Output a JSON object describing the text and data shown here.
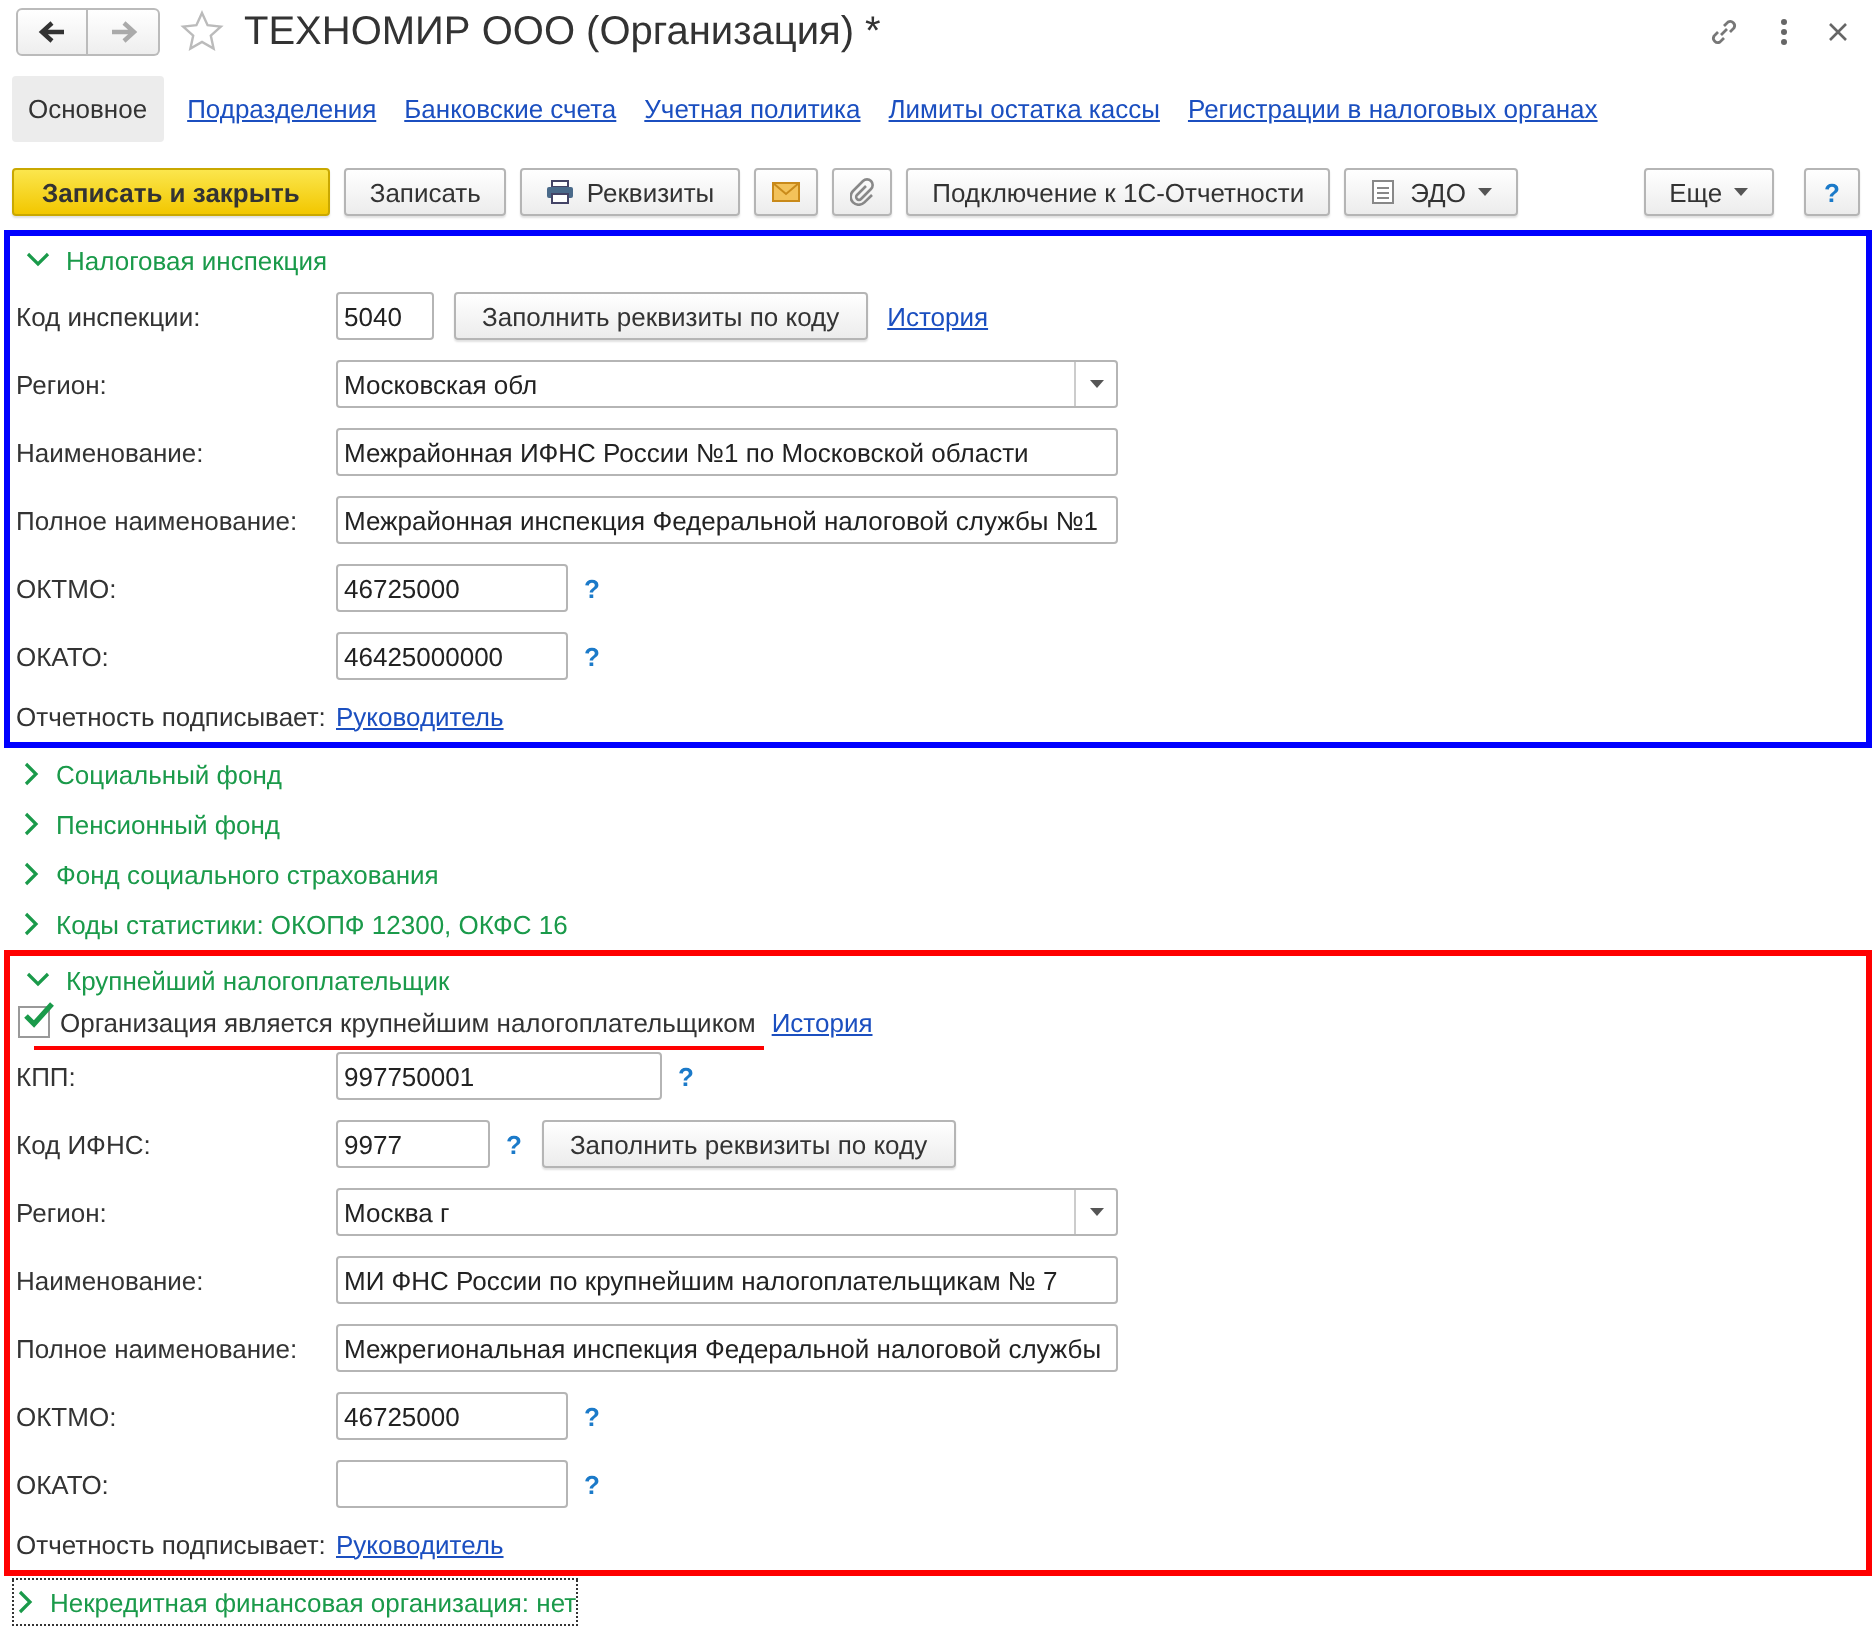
{
  "window": {
    "title": "ТЕХНОМИР ООО (Организация) *"
  },
  "tabs": [
    {
      "label": "Основное",
      "selected": true
    },
    {
      "label": "Подразделения",
      "selected": false
    },
    {
      "label": "Банковские счета",
      "selected": false
    },
    {
      "label": "Учетная политика",
      "selected": false
    },
    {
      "label": "Лимиты остатка кассы",
      "selected": false
    },
    {
      "label": "Регистрации в налоговых органах",
      "selected": false
    }
  ],
  "toolbar": [
    {
      "kind": "primary",
      "label": "Записать и закрыть"
    },
    {
      "kind": "plain",
      "label": "Записать"
    },
    {
      "kind": "printer",
      "label": "Реквизиты"
    },
    {
      "kind": "mail"
    },
    {
      "kind": "clip"
    },
    {
      "kind": "plain",
      "label": "Подключение к 1С-Отчетности"
    },
    {
      "kind": "menu-icon",
      "label": "ЭДО"
    }
  ],
  "toolbar_right": [
    {
      "kind": "menu",
      "label": "Еще"
    },
    {
      "kind": "plain",
      "label": "?"
    }
  ],
  "sections": [
    {
      "title": "Налоговая инспекция",
      "expanded": true,
      "color": "#0000ff",
      "rows": [
        {
          "kind": "code",
          "label": "Код инспекции:",
          "value": "5040",
          "button": "Заполнить реквизиты по коду",
          "link": "История"
        },
        {
          "kind": "select",
          "label": "Регион:",
          "value": "Московская обл"
        },
        {
          "kind": "text",
          "label": "Наименование:",
          "value": "Межрайонная ИФНС России №1 по Московской области"
        },
        {
          "kind": "text",
          "label": "Полное наименование:",
          "value": "Межрайонная инспекция Федеральной налоговой службы №1"
        },
        {
          "kind": "number",
          "label": "ОКТМО:",
          "value": "46725000",
          "help": "?"
        },
        {
          "kind": "number",
          "label": "ОКАТО:",
          "value": "46425000000",
          "help": "?"
        },
        {
          "kind": "link",
          "label": "Отчетность подписывает:",
          "link": "Руководитель"
        }
      ]
    },
    {
      "title": "Социальный фонд",
      "expanded": false
    },
    {
      "title": "Пенсионный фонд",
      "expanded": false
    },
    {
      "title": "Фонд социального страхования",
      "expanded": false
    },
    {
      "title": "Коды статистики: ОКОПФ 12300, ОКФС 16",
      "expanded": false
    },
    {
      "title": "Крупнейший налогоплательщик",
      "expanded": true,
      "color": "#ff0000",
      "rows": [
        {
          "kind": "checkbox",
          "label": "Организация является крупнейшим налогоплательщиком",
          "checked": true,
          "underlined": true,
          "link": "История"
        },
        {
          "kind": "kpp",
          "label": "КПП:",
          "value": "997750001",
          "help": "?"
        },
        {
          "kind": "ifns",
          "label": "Код ИФНС:",
          "value": "9977",
          "help": "?",
          "button": "Заполнить реквизиты по коду"
        },
        {
          "kind": "select",
          "label": "Регион:",
          "value": "Москва г"
        },
        {
          "kind": "text",
          "label": "Наименование:",
          "value": "МИ ФНС России по крупнейшим налогоплательщикам № 7"
        },
        {
          "kind": "text",
          "label": "Полное наименование:",
          "value": "Межрегиональная инспекция Федеральной налоговой службы"
        },
        {
          "kind": "number",
          "label": "ОКТМО:",
          "value": "46725000",
          "help": "?"
        },
        {
          "kind": "number",
          "label": "ОКАТО:",
          "help": "?"
        },
        {
          "kind": "link",
          "label": "Отчетность подписывает:",
          "link": "Руководитель"
        }
      ]
    },
    {
      "title": "Некредитная финансовая организация: нет",
      "expanded": false,
      "focused": true
    }
  ]
}
